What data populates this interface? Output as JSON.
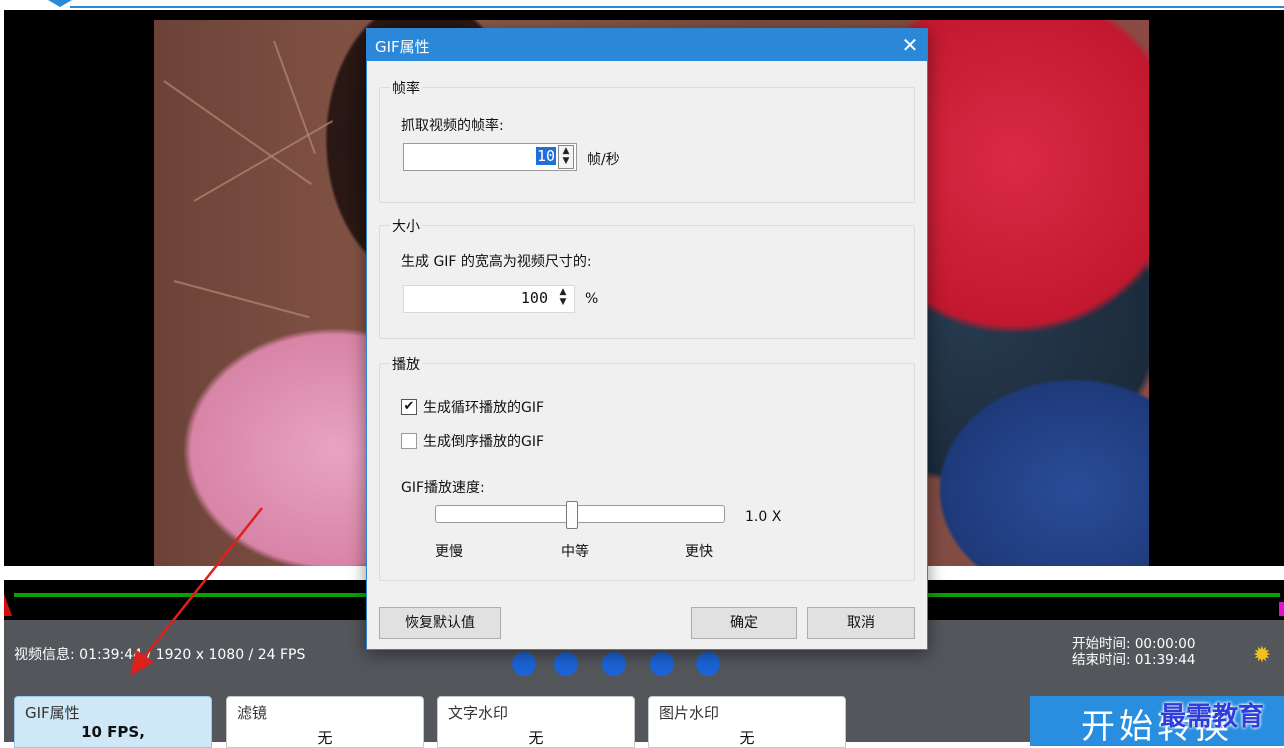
{
  "dialog": {
    "title": "GIF属性",
    "close_glyph": "✕",
    "frame_rate": {
      "group_title": "帧率",
      "prompt": "抓取视频的帧率:",
      "value": "10",
      "unit": "帧/秒"
    },
    "size": {
      "group_title": "大小",
      "prompt": "生成 GIF 的宽高为视频尺寸的:",
      "value": "100",
      "unit": "%"
    },
    "playback": {
      "group_title": "播放",
      "loop_label": "生成循环播放的GIF",
      "loop_checked": true,
      "reverse_label": "生成倒序播放的GIF",
      "reverse_checked": false,
      "speed_label": "GIF播放速度:",
      "speed_value": "1.0 X",
      "speed_fraction": 0.47,
      "slow_label": "更慢",
      "medium_label": "中等",
      "fast_label": "更快"
    },
    "buttons": {
      "reset": "恢复默认值",
      "ok": "确定",
      "cancel": "取消"
    }
  },
  "status": {
    "video_info": "视频信息: 01:39:44 / 1920 x 1080 / 24 FPS",
    "start_time": "开始时间: 00:00:00",
    "end_time": "结束时间: 01:39:44"
  },
  "tabs": [
    {
      "label": "GIF属性",
      "value": "10 FPS,"
    },
    {
      "label": "滤镜",
      "value": "无"
    },
    {
      "label": "文字水印",
      "value": "无"
    },
    {
      "label": "图片水印",
      "value": "无"
    }
  ],
  "start_button": "开始转换",
  "watermark": "最需教育",
  "icons": {
    "settings": "gear-icon",
    "close": "close-icon",
    "checkmark": "✔"
  },
  "colors": {
    "titlebar": "#2b88d8",
    "panel": "#53565b",
    "accent": "#2a8ee0",
    "arrow": "#e0201c",
    "timeline_green": "#0aa00a"
  }
}
